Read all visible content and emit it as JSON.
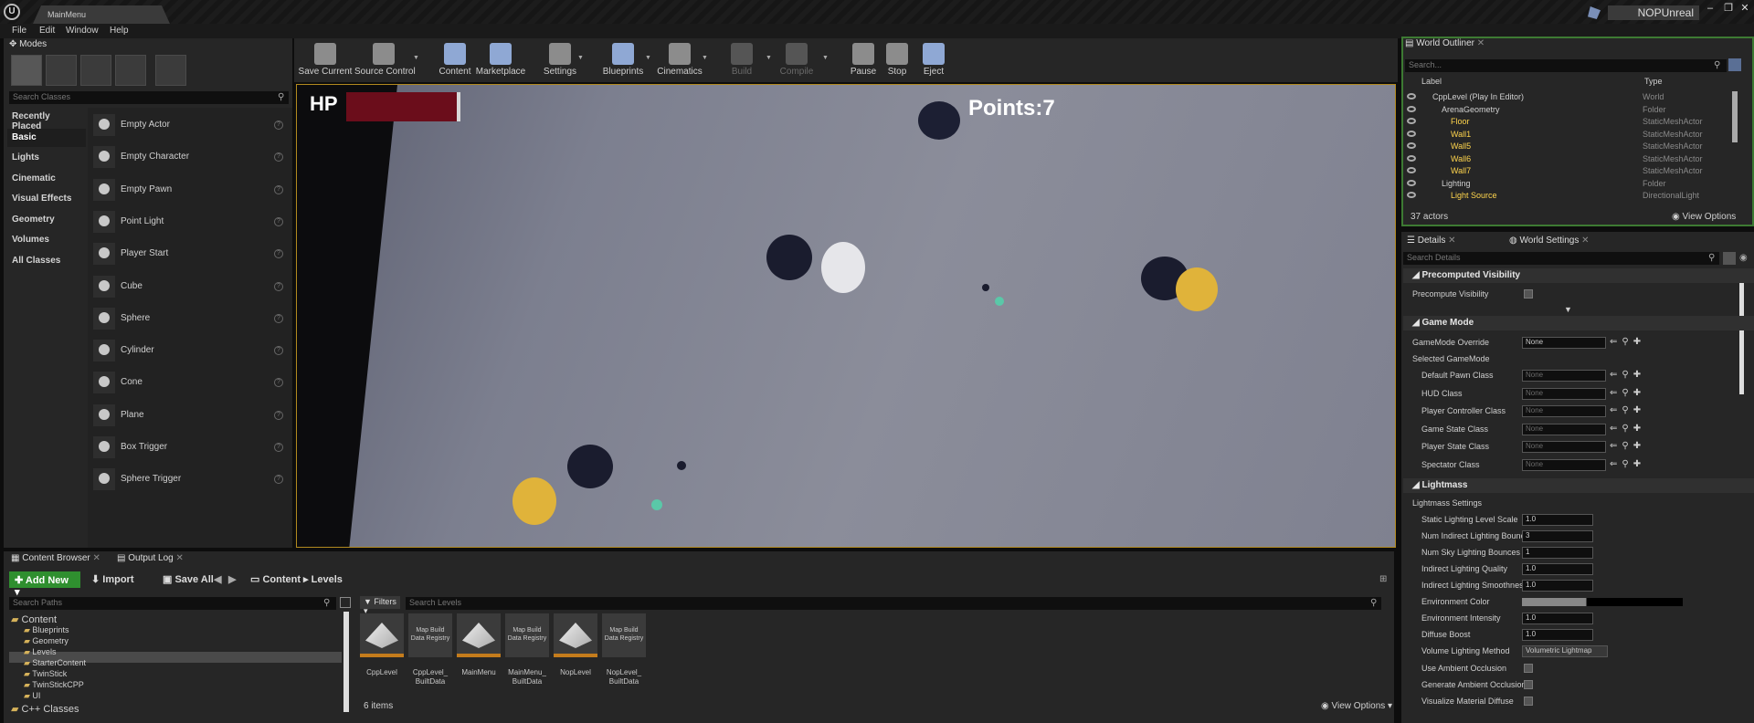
{
  "window": {
    "doc_tab": "MainMenu",
    "project_name": "NOPUnreal",
    "controls": [
      "–",
      "❐",
      "✕"
    ]
  },
  "menu": [
    "File",
    "Edit",
    "Window",
    "Help"
  ],
  "modes": {
    "tab": "Modes",
    "search_placeholder": "Search Classes",
    "categories": [
      "Recently Placed",
      "Basic",
      "Lights",
      "Cinematic",
      "Visual Effects",
      "Geometry",
      "Volumes",
      "All Classes"
    ],
    "active_category": "Basic",
    "items": [
      "Empty Actor",
      "Empty Character",
      "Empty Pawn",
      "Point Light",
      "Player Start",
      "Cube",
      "Sphere",
      "Cylinder",
      "Cone",
      "Plane",
      "Box Trigger",
      "Sphere Trigger"
    ],
    "help_glyph": "?"
  },
  "toolbar": {
    "save_current": "Save Current",
    "source_control": "Source Control",
    "content": "Content",
    "marketplace": "Marketplace",
    "settings": "Settings",
    "blueprints": "Blueprints",
    "cinematics": "Cinematics",
    "build": "Build",
    "compile": "Compile",
    "pause": "Pause",
    "stop": "Stop",
    "eject": "Eject"
  },
  "viewport": {
    "hp_label": "HP",
    "hp_fraction": 0.95,
    "points": "Points:7"
  },
  "outliner": {
    "tab": "World Outliner",
    "search_placeholder": "Search...",
    "col_label": "Label",
    "col_type": "Type",
    "rows": [
      {
        "label": "CppLevel (Play In Editor)",
        "type": "World"
      },
      {
        "label": "ArenaGeometry",
        "type": "Folder"
      },
      {
        "label": "Floor",
        "type": "StaticMeshActor"
      },
      {
        "label": "Wall1",
        "type": "StaticMeshActor"
      },
      {
        "label": "Wall5",
        "type": "StaticMeshActor"
      },
      {
        "label": "Wall6",
        "type": "StaticMeshActor"
      },
      {
        "label": "Wall7",
        "type": "StaticMeshActor"
      },
      {
        "label": "Lighting",
        "type": "Folder"
      },
      {
        "label": "Light Source",
        "type": "DirectionalLight"
      }
    ],
    "actors_count": "37 actors",
    "view_options": "View Options"
  },
  "details": {
    "tab_details": "Details",
    "tab_world_settings": "World Settings",
    "search_placeholder": "Search Details",
    "sections": {
      "precomputed": "Precomputed Visibility",
      "game_mode": "Game Mode",
      "lightmass": "Lightmass"
    },
    "precompute_visibility": "Precompute Visibility",
    "gamemode_override": "GameMode Override",
    "gamemode_override_value": "None",
    "selected_gamemode": "Selected GameMode",
    "class_rows": [
      {
        "label": "Default Pawn Class",
        "value": "None"
      },
      {
        "label": "HUD Class",
        "value": "None"
      },
      {
        "label": "Player Controller Class",
        "value": "None"
      },
      {
        "label": "Game State Class",
        "value": "None"
      },
      {
        "label": "Player State Class",
        "value": "None"
      },
      {
        "label": "Spectator Class",
        "value": "None"
      }
    ],
    "lightmass_settings": "Lightmass Settings",
    "lm_rows": [
      {
        "label": "Static Lighting Level Scale",
        "value": "1.0"
      },
      {
        "label": "Num Indirect Lighting Bounces",
        "value": "3"
      },
      {
        "label": "Num Sky Lighting Bounces",
        "value": "1"
      },
      {
        "label": "Indirect Lighting Quality",
        "value": "1.0"
      },
      {
        "label": "Indirect Lighting Smoothness",
        "value": "1.0"
      }
    ],
    "environment_color": "Environment Color",
    "environment_intensity": "Environment Intensity",
    "environment_intensity_value": "1.0",
    "diffuse_boost": "Diffuse Boost",
    "diffuse_boost_value": "1.0",
    "volume_lighting_method": "Volume Lighting Method",
    "volume_lighting_method_value": "Volumetric Lightmap",
    "use_ambient_occlusion": "Use Ambient Occlusion",
    "generate_ambient_occlusion": "Generate Ambient Occlusion",
    "visualize_material_diffuse": "Visualize Material Diffuse"
  },
  "content_browser": {
    "tab": "Content Browser",
    "tab_output": "Output Log",
    "add_new": "Add New",
    "import": "Import",
    "save_all": "Save All",
    "path": [
      "Content",
      "Levels"
    ],
    "search_paths_placeholder": "Search Paths",
    "tree": [
      {
        "label": "Content",
        "level": 0
      },
      {
        "label": "Blueprints",
        "level": 1
      },
      {
        "label": "Geometry",
        "level": 1
      },
      {
        "label": "Levels",
        "level": 1
      },
      {
        "label": "StarterContent",
        "level": 1
      },
      {
        "label": "TwinStick",
        "level": 1
      },
      {
        "label": "TwinStickCPP",
        "level": 1
      },
      {
        "label": "UI",
        "level": 1
      },
      {
        "label": "C++ Classes",
        "level": 0
      }
    ],
    "filters": "Filters",
    "search_levels_placeholder": "Search Levels",
    "assets": [
      {
        "name": "CppLevel",
        "kind": "map"
      },
      {
        "name": "CppLevel_ BuiltData",
        "kind": "registry",
        "thumb": "Map Build Data Registry"
      },
      {
        "name": "MainMenu",
        "kind": "map"
      },
      {
        "name": "MainMenu_ BuiltData",
        "kind": "registry",
        "thumb": "Map Build Data Registry"
      },
      {
        "name": "NopLevel",
        "kind": "map"
      },
      {
        "name": "NopLevel_ BuiltData",
        "kind": "registry",
        "thumb": "Map Build Data Registry"
      }
    ],
    "items_count": "6 items",
    "view_options": "View Options"
  },
  "colors": {
    "accent_green": "#2f8f2f",
    "hp_red": "#6b0d1b",
    "selection_gold": "#b28a1f",
    "outliner_border": "#3d7a33"
  }
}
